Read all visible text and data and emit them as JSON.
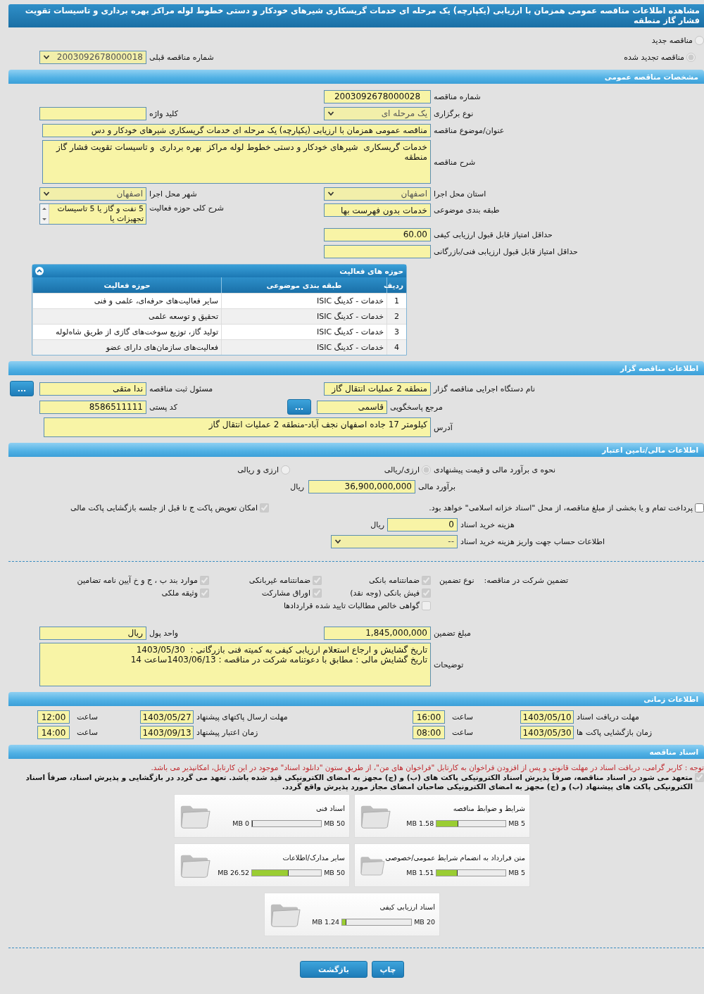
{
  "page_title": "مشاهده اطلاعات مناقصه عمومی همزمان با ارزیابی (یکپارچه) یک مرحله ای خدمات گریسکاری شیرهای خودکار و دستی خطوط لوله مراکز بهره برداری و تاسیسات تقویت فشار گاز منطقه",
  "tender_type": {
    "disabled": true,
    "options": [
      {
        "label": "مناقصه جدید",
        "selected": false
      },
      {
        "label": "مناقصه تجدید شده",
        "selected": true
      }
    ]
  },
  "previous_tender": {
    "label": "شماره مناقصه قبلی",
    "value": "2003092678000018"
  },
  "general": {
    "title": "مشخصات مناقصه عمومی",
    "tender_number": {
      "label": "شماره مناقصه",
      "value": "2003092678000028"
    },
    "holding_type": {
      "label": "نوع برگزاری",
      "value": "یک مرحله ای"
    },
    "keyword": {
      "label": "کلید واژه"
    },
    "subject": {
      "label": "عنوان/موضوع مناقصه",
      "value": "مناقصه عمومی همزمان با ارزیابی (یکپارچه) یک مرحله ای خدمات گریسکاری  شیرهای خودکار و دس"
    },
    "description": {
      "label": "شرح مناقصه",
      "value": "خدمات گریسکاری  شیرهای خودکار و دستی خطوط لوله مراکز  بهره برداری  و تاسیسات تقویت فشار گاز منطقه"
    },
    "province": {
      "label": "استان محل اجرا",
      "value": "اصفهان"
    },
    "city": {
      "label": "شهر محل اجرا",
      "value": "اصفهان"
    },
    "category": {
      "label": "طبقه بندی موضوعی",
      "value": "خدمات بدون فهرست بها"
    },
    "activity_scope": {
      "label": "شرح کلی حوزه فعالیت",
      "value": "5 نفت و گاز یا 5 تاسیسات تجهیزات  یا"
    },
    "min_quality_score": {
      "label": "حداقل امتیاز قابل قبول ارزیابی کیفی",
      "value": "60.00"
    },
    "min_technical_score": {
      "label": "حداقل امتیاز قابل قبول ارزیابی فنی/بازرگانی"
    }
  },
  "activity_table": {
    "title": "حوزه های فعالیت",
    "columns": [
      "ردیف",
      "طبقه بندی موضوعی",
      "حوزه فعالیت"
    ],
    "rows": [
      [
        "1",
        "خدمات - کدینگ ISIC",
        "سایر فعالیت‌های حرفه‌ای، علمی و فنی"
      ],
      [
        "2",
        "خدمات - کدینگ ISIC",
        "تحقیق و توسعه علمی"
      ],
      [
        "3",
        "خدمات - کدینگ ISIC",
        "تولید گاز، توزیع سوخت‌های گازی از طریق شاه‌لوله"
      ],
      [
        "4",
        "خدمات - کدینگ ISIC",
        "فعالیت‌های سازمان‌های دارای عضو"
      ]
    ]
  },
  "organizer": {
    "title": "اطلاعات مناقصه گزار",
    "executive": {
      "label": "نام دستگاه اجرایی مناقصه گزار",
      "value": "منطقه 2 عملیات انتقال گاز"
    },
    "registrar": {
      "label": "مسئول ثبت مناقصه",
      "value": "ندا متقی",
      "button": "..."
    },
    "reference": {
      "label": "مرجع پاسخگویی",
      "value": "قاسمی",
      "button": "..."
    },
    "postal_code": {
      "label": "کد پستی",
      "value": "8586511111"
    },
    "address": {
      "label": "آدرس",
      "value": "کیلومتر 17 جاده اصفهان نجف آباد-منطقه 2 عملیات انتقال گاز"
    }
  },
  "financial": {
    "title": "اطلاعات مالی/تامین اعتبار",
    "estimate_method": {
      "label": "نحوه ی برآورد مالی و قیمت پیشنهادی",
      "disabled": true,
      "options": [
        {
          "label": "ارزی/ریالی",
          "selected": true
        },
        {
          "label": "ارزی و ریالی",
          "selected": false
        }
      ]
    },
    "estimate": {
      "label": "برآورد مالی",
      "value": "36,900,000,000",
      "unit": "ریال"
    },
    "treasury_bonds": {
      "label": "پرداخت تمام و یا بخشی از مبلغ مناقصه، از محل \"اسناد خزانه اسلامی\" خواهد بود.",
      "checked": false,
      "disabled": false
    },
    "envelope_swap": {
      "label": "امکان تعویض پاکت ج تا قبل از جلسه بازگشایی پاکت مالی",
      "checked": true,
      "disabled": true
    },
    "doc_fee": {
      "label": "هزینه خرید اسناد",
      "value": "0",
      "unit": "ریال"
    },
    "account": {
      "label": "اطلاعات حساب جهت واریز هزینه خرید اسناد",
      "value": "--"
    }
  },
  "guarantee": {
    "label": "تضمین شرکت در مناقصه:",
    "type_label": "نوع تضمین",
    "options": [
      {
        "label": "ضمانتنامه بانکی",
        "checked": true,
        "disabled": true
      },
      {
        "label": "ضمانتنامه غیربانکی",
        "checked": true,
        "disabled": true
      },
      {
        "label": "موارد بند ب ، ج و خ آیین نامه تضامین",
        "checked": true,
        "disabled": true
      },
      {
        "label": "فیش بانکی (وجه نقد)",
        "checked": true,
        "disabled": true
      },
      {
        "label": "اوراق مشارکت",
        "checked": true,
        "disabled": true
      },
      {
        "label": "وثیقه ملکی",
        "checked": true,
        "disabled": true
      },
      {
        "label": "گواهی خالص مطالبات تایید شده قراردادها",
        "checked": false,
        "disabled": true
      }
    ],
    "amount": {
      "label": "مبلغ تضمین",
      "value": "1,845,000,000"
    },
    "currency": {
      "label": "واحد پول",
      "value": "ریال"
    },
    "notes": {
      "label": "توضیحات",
      "lines": [
        "تاریخ گشایش و ارجاع استعلام ارزیابی کیفی به کمیته فنی بازرگانی :  1403/05/30",
        "تاریخ گشایش مالی : مطابق با دعوتنامه شرکت در مناقصه : 1403/06/13ساعت 14"
      ]
    }
  },
  "timing": {
    "title": "اطلاعات زمانی",
    "rows": [
      [
        {
          "label": "مهلت دریافت اسناد",
          "date": "1403/05/10",
          "time_label": "ساعت",
          "time": "16:00"
        },
        {
          "label": "مهلت ارسال پاکتهای پیشنهاد",
          "date": "1403/05/27",
          "time_label": "ساعت",
          "time": "12:00"
        }
      ],
      [
        {
          "label": "زمان بازگشایی پاکت ها",
          "date": "1403/05/30",
          "time_label": "ساعت",
          "time": "08:00"
        },
        {
          "label": "زمان اعتبار پیشنهاد",
          "date": "1403/09/13",
          "time_label": "ساعت",
          "time": "14:00"
        }
      ]
    ]
  },
  "documents": {
    "title": "اسناد مناقصه",
    "notice": "توجه : کاربر گرامی، دریافت اسناد در مهلت قانونی و پس از افزودن فراخوان به کارتابل \"فراخوان های من\"، از طریق ستون \"دانلود اسناد\" موجود در این کارتابل، امکانپذیر می باشد.",
    "commitment": {
      "label": "متعهد می شود در اسناد مناقصه، صرفاً پذیرش اسناد الکترونیکی پاکت های (ب) و (ج) مجهز به امضای الکترونیکی قید شده باشد. تعهد می گردد در بازگشایی و پذیرش اسناد، صرفاً اسناد الکترونیکی پاکت های پیشنهاد (ب) و (ج) مجهز به امضای الکترونیکی صاحبان امضای مجاز مورد پذیرش واقع گردد.",
      "checked": true,
      "disabled": true
    },
    "cards": [
      {
        "title": "شرایط و ضوابط مناقصه",
        "used": "1.58 MB",
        "max": "5 MB",
        "level": 0.316
      },
      {
        "title": "اسناد فنی",
        "used": "0 MB",
        "max": "50 MB",
        "level": 0
      },
      {
        "title": "متن قرارداد به انضمام شرایط عمومی/خصوصی",
        "used": "1.51 MB",
        "max": "5 MB",
        "level": 0.302
      },
      {
        "title": "سایر مدارک/اطلاعات",
        "used": "26.52 MB",
        "max": "50 MB",
        "level": 0.53
      },
      {
        "title": "اسناد ارزیابی کیفی",
        "used": "1.24 MB",
        "max": "20 MB",
        "level": 0.062
      }
    ]
  },
  "buttons": [
    "چاپ",
    "بازگشت"
  ]
}
